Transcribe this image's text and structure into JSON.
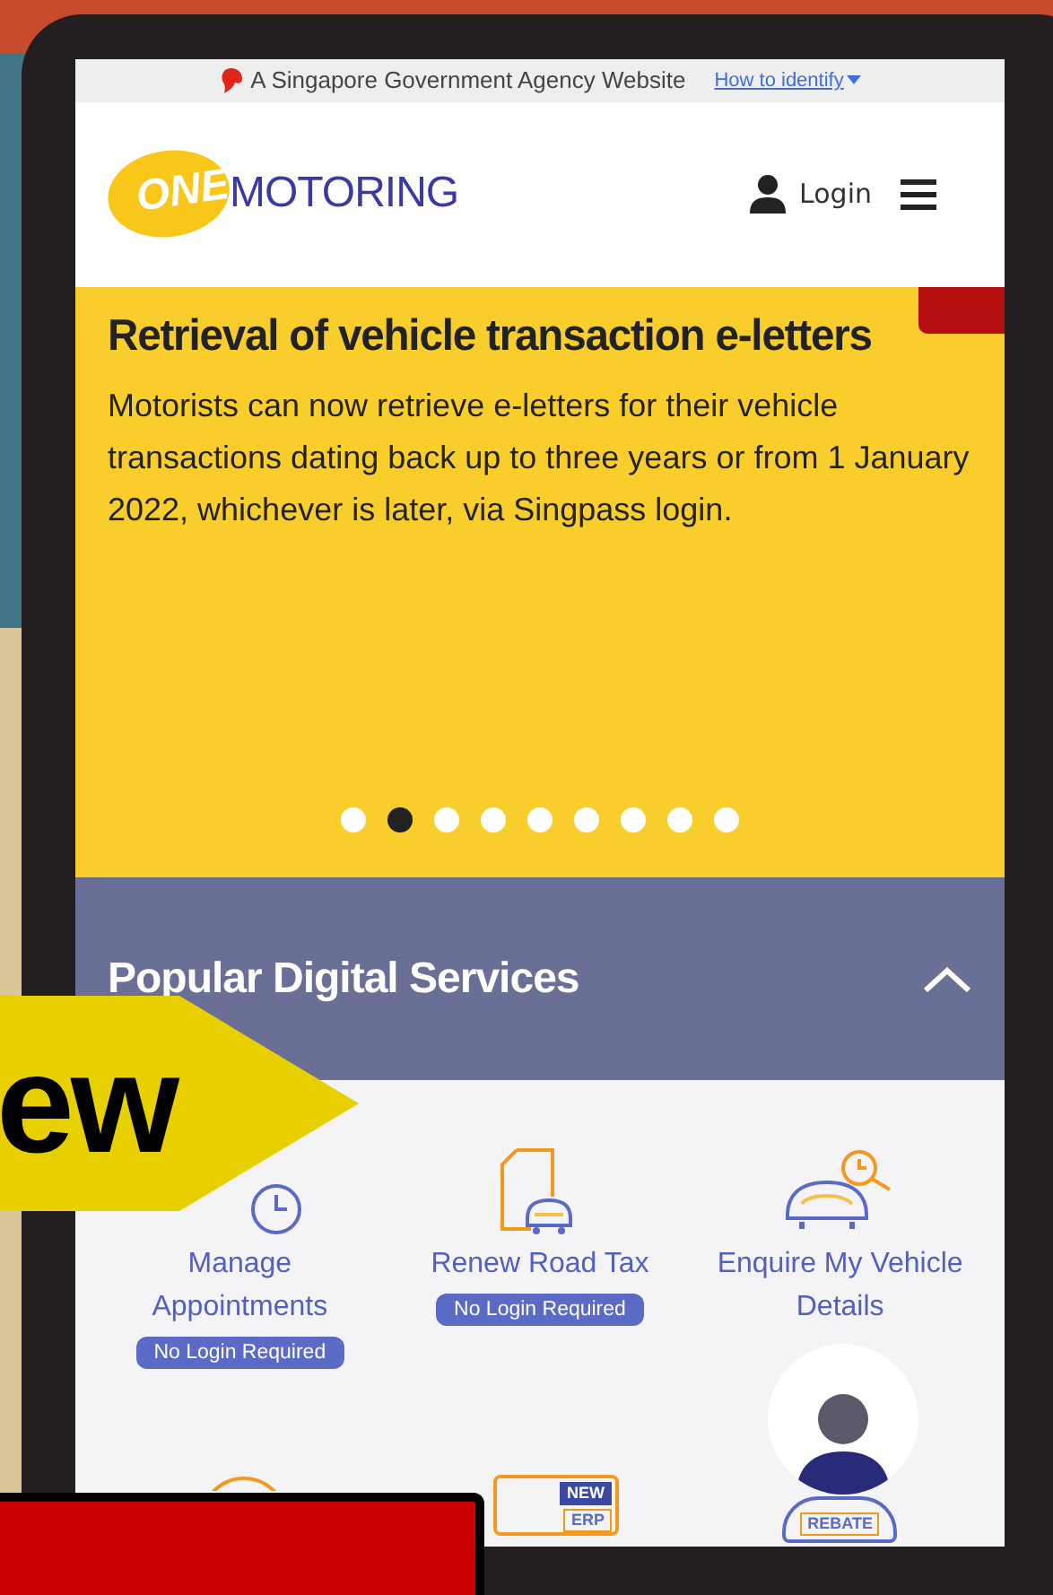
{
  "gov_banner": {
    "text": "A Singapore Government Agency Website",
    "link": "How to identify"
  },
  "header": {
    "logo_highlight": "ONE",
    "logo_rest": "MOTORING",
    "login": "Login"
  },
  "carousel": {
    "title": "Retrieval of vehicle transaction e-letters",
    "body": "Motorists can now retrieve e-letters for their vehicle transactions dating back up to three years or from 1 January 2022, whichever is later, via Singpass login.",
    "dots": [
      {
        "selected": false
      },
      {
        "selected": true
      },
      {
        "selected": false
      },
      {
        "selected": false
      },
      {
        "selected": false
      },
      {
        "selected": false
      },
      {
        "selected": false
      },
      {
        "selected": false
      },
      {
        "selected": false
      }
    ]
  },
  "services": {
    "title": "Popular Digital Services",
    "expanded": true,
    "items": [
      {
        "kind": "appointment",
        "label": "Manage Appointments",
        "badge": "No Login Required"
      },
      {
        "kind": "roadtax",
        "label": "Renew Road Tax",
        "badge": "No Login Required"
      },
      {
        "kind": "enquire",
        "label": "Enquire My Vehicle Details"
      },
      {
        "kind": "gauge"
      },
      {
        "kind": "erp",
        "tags": [
          "NEW",
          "ERP"
        ]
      },
      {
        "kind": "rebate",
        "tags": [
          "REBATE"
        ]
      }
    ]
  },
  "overlay_banner": {
    "text": "ew"
  }
}
